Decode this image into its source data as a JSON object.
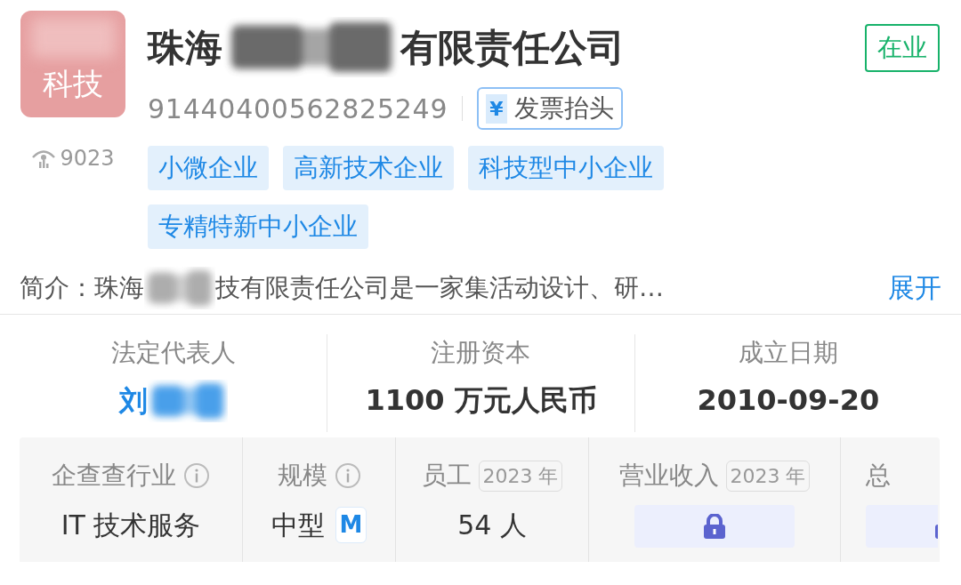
{
  "logo": {
    "text": "科技"
  },
  "views": "9023",
  "title": {
    "start": "珠海",
    "end": "有限责任公司"
  },
  "status": "在业",
  "credit_code": "91440400562825249",
  "invoice_button": {
    "icon": "¥",
    "label": "发票抬头"
  },
  "tags": [
    "小微企业",
    "高新技术企业",
    "科技型中小企业",
    "专精特新中小企业"
  ],
  "intro": {
    "label": "简介：",
    "start": "珠海",
    "end": "技有限责任公司是一家集活动设计、研…",
    "more": "展开"
  },
  "stats": [
    {
      "label": "法定代表人",
      "value": "刘",
      "kind": "link"
    },
    {
      "label": "注册资本",
      "value": "1100 万元人民币",
      "kind": "text"
    },
    {
      "label": "成立日期",
      "value": "2010-09-20",
      "kind": "text"
    }
  ],
  "metrics": [
    {
      "label": "企查查行业",
      "info": true,
      "value": "IT 技术服务",
      "kind": "text"
    },
    {
      "label": "规模",
      "info": true,
      "value": "中型",
      "badge": "M",
      "kind": "text"
    },
    {
      "label": "员工",
      "year": "2023 年",
      "value": "54 人",
      "kind": "text"
    },
    {
      "label": "营业收入",
      "year": "2023 年",
      "kind": "locked"
    },
    {
      "label": "总",
      "kind": "locked"
    }
  ]
}
